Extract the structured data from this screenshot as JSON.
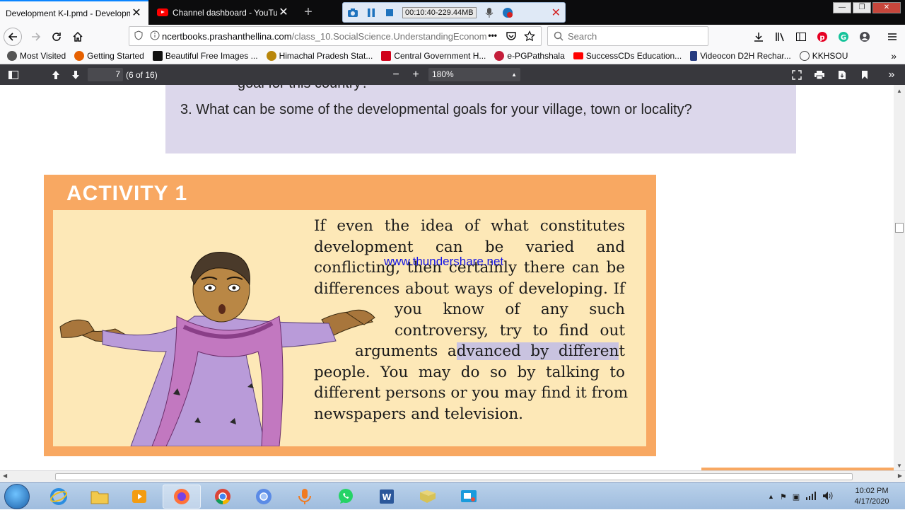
{
  "tabs": [
    {
      "title": "Development K-I.pmd - Developme",
      "active": true
    },
    {
      "title": "Channel dashboard - YouTube",
      "active": false
    }
  ],
  "recorder": {
    "time": "00:10:40-229.44MB"
  },
  "navbar": {
    "url_host": "ncertbooks.prashanthellina.com",
    "url_path": "/class_10.SocialScience.UnderstandingEconom",
    "search_placeholder": "Search"
  },
  "bookmarks": [
    {
      "label": "Most Visited",
      "icon": "gear-icon",
      "color": "#555555"
    },
    {
      "label": "Getting Started",
      "icon": "firefox-icon",
      "color": "#e66000"
    },
    {
      "label": "Beautiful Free Images ...",
      "icon": "camera-icon",
      "color": "#111111"
    },
    {
      "label": "Himachal Pradesh Stat...",
      "icon": "emblem-icon",
      "color": "#b8860b"
    },
    {
      "label": "Central Government H...",
      "icon": "g-icon",
      "color": "#d0021b"
    },
    {
      "label": "e-PGPathshala",
      "icon": "e-icon",
      "color": "#c41e3a"
    },
    {
      "label": "SuccessCDs Education...",
      "icon": "youtube-icon",
      "color": "#ff0000"
    },
    {
      "label": "Videocon D2H Rechar...",
      "icon": "p-icon",
      "color": "#253b80"
    },
    {
      "label": "KKHSOU",
      "icon": "globe-icon",
      "color": "#444444"
    }
  ],
  "pdf": {
    "page": "7",
    "page_count": "(6 of 16)",
    "zoom": "180%"
  },
  "document": {
    "prev_question_fragment": "goal for this country?",
    "question3": "3.  What can be some of the developmental goals for your village, town or locality?",
    "activity_title": "ACTIVITY 1",
    "activity_lines": [
      "If even the idea of what constitutes",
      "development can be varied and",
      "conflicting, then certainly there can be",
      "differences about ways of developing. If",
      "you know of any such",
      "controversy, try to find out",
      "people. You may do so by talking to",
      "different persons or you may find it from",
      "newspapers and television."
    ],
    "args_line_plain": "arguments a",
    "args_line_highlight": "dvanced by differen",
    "args_line_tail": "t",
    "watermark": "www.thundershare.net"
  },
  "clock": {
    "time": "10:02 PM",
    "date": "4/17/2020"
  },
  "colors": {
    "activity_border": "#f8a862",
    "activity_fill": "#fde8b7",
    "question_box": "#dcd7eb",
    "tab_accent": "#0a84ff",
    "pdf_toolbar": "#38383d"
  }
}
